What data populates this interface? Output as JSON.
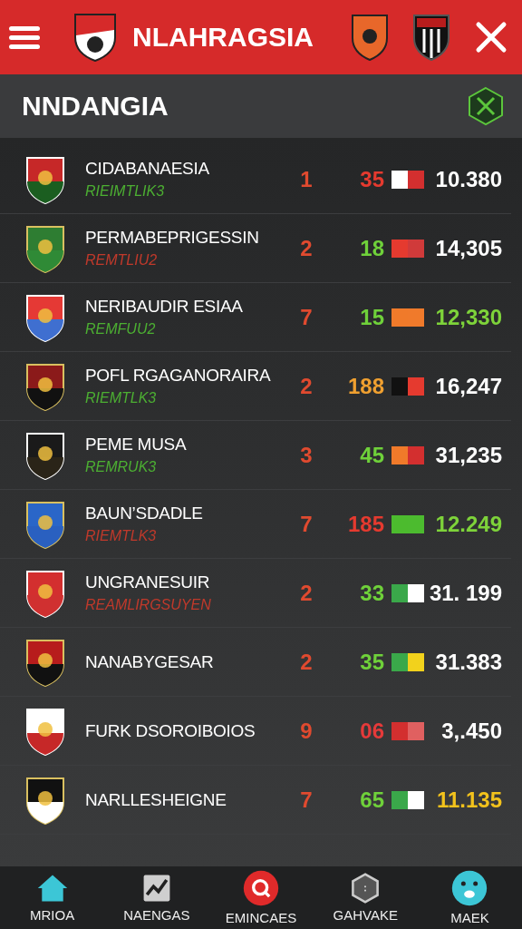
{
  "header": {
    "title": "NLAHRAGSIA"
  },
  "section": {
    "title": "NNDANGIA"
  },
  "rows": [
    {
      "name": "CIDABANAESIA",
      "sub": {
        "text": "RIEIMTLIK3",
        "color": "#4caf32"
      },
      "rank": "1",
      "count": {
        "text": "35",
        "color": "#e53a2f"
      },
      "swatch": [
        {
          "color": "#ffffff"
        },
        {
          "color": "#d32f2f"
        }
      ],
      "value": {
        "text": "10.380",
        "color": "#ffffff"
      },
      "crest": [
        {
          "color": "#c62828"
        },
        {
          "color": "#1b5e20"
        }
      ]
    },
    {
      "name": "PERMABEPRIGESSIN",
      "sub": {
        "text": "REMTLIU2",
        "color": "#c0392b"
      },
      "rank": "2",
      "count": {
        "text": "18",
        "color": "#6fd13a"
      },
      "swatch": [
        {
          "color": "#e53a2f"
        },
        {
          "color": "#d03a3a"
        }
      ],
      "value": {
        "text": "14,305",
        "color": "#ffffff"
      },
      "crest": [
        {
          "color": "#2e7d32"
        },
        {
          "color": "#2f8a36"
        }
      ]
    },
    {
      "name": "NERIBAUDIR ESIAA",
      "sub": {
        "text": "REMFUU2",
        "color": "#4caf32"
      },
      "rank": "7",
      "count": {
        "text": "15",
        "color": "#6fd13a"
      },
      "swatch": [
        {
          "color": "#f07a2a"
        },
        {
          "color": "#f07a2b"
        }
      ],
      "value": {
        "text": "12,330",
        "color": "#7ed33a"
      },
      "crest": [
        {
          "color": "#e53935"
        },
        {
          "color": "#3f6fd0"
        }
      ]
    },
    {
      "name": "POFL RGAGANORAIRA",
      "sub": {
        "text": "RIEMTLK3",
        "color": "#4caf32"
      },
      "rank": "2",
      "count": {
        "text": "188",
        "color": "#f0a030"
      },
      "swatch": [
        {
          "color": "#111111"
        },
        {
          "color": "#e53a2f"
        }
      ],
      "value": {
        "text": "16,247",
        "color": "#ffffff"
      },
      "crest": [
        {
          "color": "#8b1a1a"
        },
        {
          "color": "#111111"
        }
      ]
    },
    {
      "name": "PEME MUSA",
      "sub": {
        "text": "REMRUK3",
        "color": "#4caf32"
      },
      "rank": "3",
      "count": {
        "text": "45",
        "color": "#6fd13a"
      },
      "swatch": [
        {
          "color": "#f07a2a"
        },
        {
          "color": "#d32f2f"
        }
      ],
      "value": {
        "text": "31,235",
        "color": "#ffffff"
      },
      "crest": [
        {
          "color": "#1a1a1a"
        },
        {
          "color": "#2a2418"
        }
      ]
    },
    {
      "name": "BAUN’SDADLE",
      "sub": {
        "text": "RIEMTLK3",
        "color": "#c0392b"
      },
      "rank": "7",
      "count": {
        "text": "185",
        "color": "#e53a2f"
      },
      "swatch": [
        {
          "color": "#4cbb2e"
        },
        {
          "color": "#4cbb2f"
        }
      ],
      "value": {
        "text": "12.249",
        "color": "#7ed33a"
      },
      "crest": [
        {
          "color": "#2a66c8"
        },
        {
          "color": "#2a60c0"
        }
      ]
    },
    {
      "name": "UNGRANESUIR",
      "sub": {
        "text": "REAMLIRGSUYEN",
        "color": "#c0392b"
      },
      "rank": "2",
      "count": {
        "text": "33",
        "color": "#6fd13a"
      },
      "swatch": [
        {
          "color": "#3aa84a"
        },
        {
          "color": "#ffffff"
        }
      ],
      "value": {
        "text": "31. 199",
        "color": "#ffffff"
      },
      "crest": [
        {
          "color": "#d32f2f"
        },
        {
          "color": "#d03030"
        }
      ]
    },
    {
      "name": "NANABYGESAR",
      "rank": "2",
      "count": {
        "text": "35",
        "color": "#6fd13a"
      },
      "swatch": [
        {
          "color": "#3aa84a"
        },
        {
          "color": "#f2d21c"
        }
      ],
      "value": {
        "text": "31.383",
        "color": "#ffffff"
      },
      "crest": [
        {
          "color": "#b71c1c"
        },
        {
          "color": "#111111"
        }
      ]
    },
    {
      "name": "FURK DSOROIBOIOS",
      "rank": "9",
      "count": {
        "text": "06",
        "color": "#e53a3a"
      },
      "swatch": [
        {
          "color": "#d32f2f"
        },
        {
          "color": "#e06060"
        }
      ],
      "value": {
        "text": "3,.450",
        "color": "#ffffff"
      },
      "crest": [
        {
          "color": "#ffffff"
        },
        {
          "color": "#c62828"
        }
      ]
    },
    {
      "name": "NARLLESHEIGNE",
      "rank": "7",
      "count": {
        "text": "65",
        "color": "#6fd13a"
      },
      "swatch": [
        {
          "color": "#3aa84a"
        },
        {
          "color": "#ffffff"
        }
      ],
      "value": {
        "text": "11.135",
        "color": "#f2c21c"
      },
      "crest": [
        {
          "color": "#111111"
        },
        {
          "color": "#ffffff"
        }
      ]
    }
  ],
  "nav": [
    {
      "label": "MRIOA",
      "kind": "home"
    },
    {
      "label": "NAENGAS",
      "kind": "chart"
    },
    {
      "label": "EMINCAES",
      "kind": "search"
    },
    {
      "label": "GAHVAKE",
      "kind": "hex"
    },
    {
      "label": "MAEK",
      "kind": "face"
    }
  ]
}
